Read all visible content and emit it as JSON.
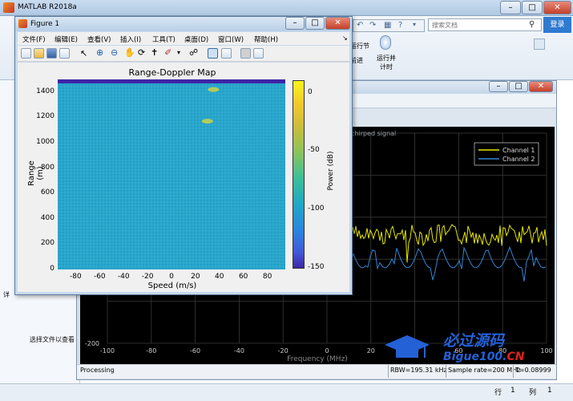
{
  "main_window": {
    "title": "MATLAB R2018a",
    "search_placeholder": "搜索文档",
    "login_label": "登录",
    "toolbar_labels": [
      "运行节",
      "前进",
      "运行并\n计时"
    ],
    "left_panel_message": "选择文件以查看",
    "status": {
      "line_label": "行",
      "line_value": "1",
      "col_label": "列",
      "col_value": "1"
    },
    "colors": {
      "title_bar": "#c2d7ec",
      "login_button": "#2f7ad0"
    }
  },
  "figure_window": {
    "title": "Figure 1",
    "menu": [
      "文件(F)",
      "编辑(E)",
      "查看(V)",
      "插入(I)",
      "工具(T)",
      "桌面(D)",
      "窗口(W)",
      "帮助(H)"
    ],
    "toolbar_icons": [
      "new-file-icon",
      "open-folder-icon",
      "save-icon",
      "print-icon",
      "pointer-icon",
      "zoom-in-icon",
      "zoom-out-icon",
      "pan-icon",
      "rotate-icon",
      "data-cursor-icon",
      "brush-icon",
      "link-icon",
      "dock-icon",
      "plot-tools-icon",
      "legend-icon",
      "colorbar-icon"
    ]
  },
  "chart_data": [
    {
      "type": "heatmap",
      "title": "Range-Doppler Map",
      "xlabel": "Speed (m/s)",
      "ylabel": "Range (m)",
      "x_ticks": [
        -80,
        -60,
        -40,
        -20,
        0,
        20,
        40,
        60,
        80
      ],
      "y_ticks": [
        0,
        200,
        400,
        600,
        800,
        1000,
        1200,
        1400
      ],
      "xlim": [
        -95,
        95
      ],
      "ylim": [
        0,
        1500
      ],
      "colorbar": {
        "label": "Power (dB)",
        "ticks": [
          0,
          -50,
          -100,
          -150
        ],
        "range": [
          -150,
          10
        ]
      },
      "background_level_db": -80,
      "targets": [
        {
          "speed": 35,
          "range": 1420
        },
        {
          "speed": 30,
          "range": 1170
        }
      ],
      "top_band_db": -150
    },
    {
      "type": "line",
      "title": "chirped signal",
      "xlabel": "Frequency (MHz)",
      "x_ticks": [
        -100,
        -80,
        -60,
        -40,
        -20,
        0,
        20,
        40,
        60,
        80,
        100
      ],
      "y_ticks_visible": [
        -200
      ],
      "xlim": [
        -100,
        100
      ],
      "series": [
        {
          "name": "Channel 1",
          "color": "#e6e600"
        },
        {
          "name": "Channel 2",
          "color": "#2f86d6"
        }
      ],
      "grid": true,
      "legend_position": "top-right"
    }
  ],
  "scope_window": {
    "status_text": "Processing",
    "rbw": "RBW=195.31 kHz",
    "sample_rate": "Sample rate=200 MHz",
    "time": "T=0.08999"
  },
  "watermark": {
    "text": "必过源码",
    "url_main": "Bigue100.",
    "url_tld": "CN"
  }
}
